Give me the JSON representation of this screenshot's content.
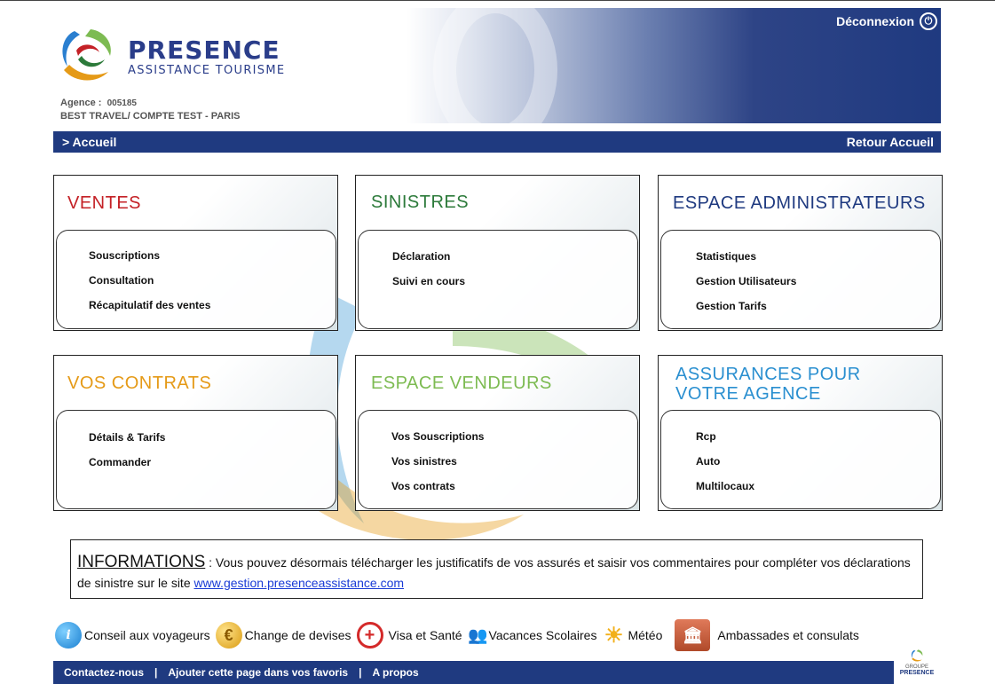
{
  "header": {
    "brand_name": "PRESENCE",
    "brand_sub": "ASSISTANCE TOURISME",
    "agency_label": "Agence :",
    "agency_number": "005185",
    "agency_name": "BEST TRAVEL/ COMPTE TEST - PARIS",
    "logout_label": "Déconnexion"
  },
  "nav": {
    "breadcrumb": "> Accueil",
    "back_label": "Retour Accueil"
  },
  "panels": [
    {
      "title": "VENTES",
      "items": [
        "Souscriptions",
        "Consultation",
        "Récapitulatif des ventes"
      ]
    },
    {
      "title": "SINISTRES",
      "items": [
        "Déclaration",
        "Suivi en cours"
      ]
    },
    {
      "title": "ESPACE ADMINISTRATEURS",
      "items": [
        "Statistiques",
        "Gestion Utilisateurs",
        "Gestion Tarifs"
      ]
    },
    {
      "title": "VOS CONTRATS",
      "items": [
        "Détails & Tarifs",
        "Commander"
      ]
    },
    {
      "title": "ESPACE VENDEURS",
      "items": [
        "Vos Souscriptions",
        "Vos sinistres",
        "Vos contrats"
      ]
    },
    {
      "title_line1": "ASSURANCES POUR",
      "title_line2": "VOTRE AGENCE",
      "items": [
        "Rcp",
        "Auto",
        "Multilocaux"
      ]
    }
  ],
  "info": {
    "title": "INFORMATIONS",
    "text": " : Vous pouvez désormais télécharger les justificatifs de vos assurés et saisir vos commentaires pour compléter vos déclarations de sinistre  sur le site  ",
    "link": "www.gestion.presenceassistance.com"
  },
  "services": [
    {
      "label": "Conseil aux voyageurs",
      "icon": "info-icon"
    },
    {
      "label": "Change de devises",
      "icon": "euro-icon"
    },
    {
      "label": "Visa et Santé",
      "icon": "health-cross-icon"
    },
    {
      "label": "Vacances Scolaires",
      "icon": "people-icon"
    },
    {
      "label": "Météo",
      "icon": "sun-icon"
    },
    {
      "label": "Ambassades et consulats",
      "icon": "building-icon"
    }
  ],
  "footer": {
    "contact": "Contactez-nous",
    "favorites": "Ajouter cette page dans vos favoris",
    "about": "A propos",
    "sep": "|",
    "groupe_label": "GROUPE",
    "groupe_name": "PRESENCE"
  },
  "colors": {
    "navy": "#1f3a80",
    "red": "#c42126",
    "green": "#2c7a3a",
    "orange": "#e59a17",
    "lightgreen": "#7dbb52",
    "cyan": "#2a8fd0"
  }
}
